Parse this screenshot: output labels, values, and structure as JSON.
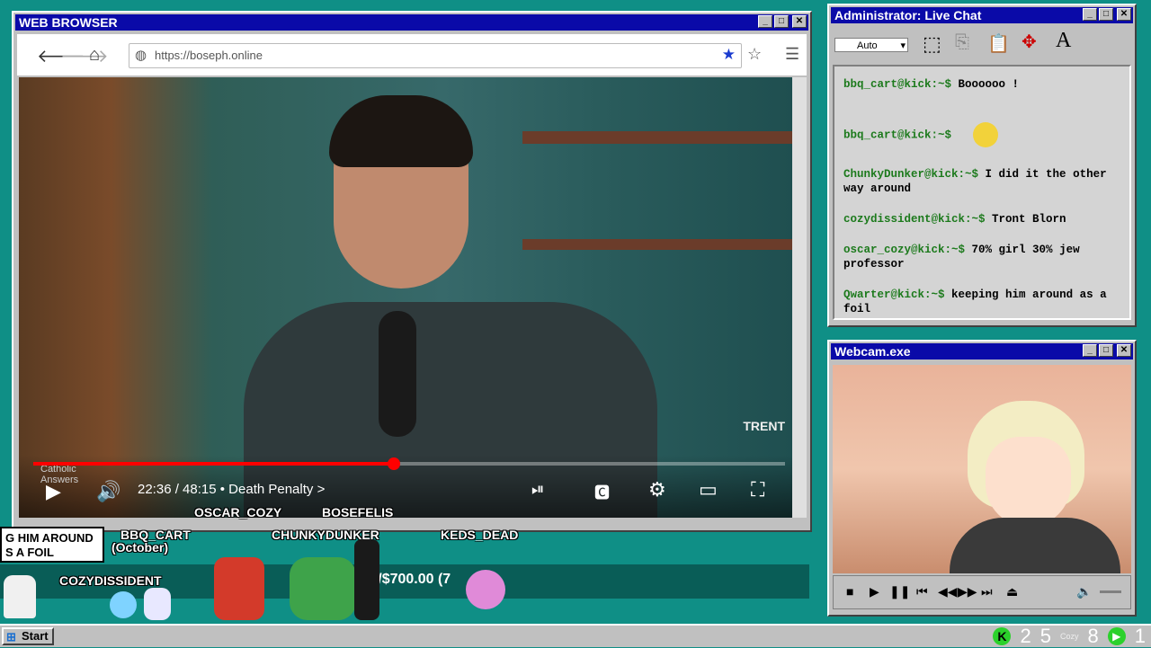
{
  "browser": {
    "title": "WEB BROWSER",
    "url": "https://boseph.online",
    "video": {
      "time": "22:36 / 48:15",
      "chapter": "Death Penalty",
      "chapter_arrow": ">",
      "brand_watermark": "TRENT",
      "channel_watermark_line1": "Catholic",
      "channel_watermark_line2": "Answers",
      "progress": 0.48
    }
  },
  "chat": {
    "title": "Administrator: Live Chat",
    "select_value": "Auto",
    "messages": [
      {
        "user": "bbq_cart@kick:~$",
        "text": "Boooooo !"
      },
      {
        "user": "bbq_cart@kick:~$",
        "text": ""
      },
      {
        "user": "ChunkyDunker@kick:~$",
        "text": "I did it the other way around"
      },
      {
        "user": "cozydissident@kick:~$",
        "text": "Tront Blorn"
      },
      {
        "user": "oscar_cozy@kick:~$",
        "text": "70% girl 30% jew professor"
      },
      {
        "user": "Qwarter@kick:~$",
        "text": "keeping him around as a foil"
      }
    ]
  },
  "webcam": {
    "title": "Webcam.exe"
  },
  "overlay": {
    "speech_line1": "G HIM AROUND",
    "speech_line2": "S A FOIL",
    "nicks": [
      "OSCAR_COZY",
      "BOSEFELIS",
      "BBQ_CART",
      "CHUNKYDUNKER",
      "KEDS_DEAD",
      "COZYDISSIDENT"
    ],
    "october": "(October)",
    "goal_text": ".00/$700.00 (7"
  },
  "taskbar": {
    "start": "Start",
    "tray_1": "2",
    "tray_2": "5",
    "tray_3": "Cozy",
    "tray_4": "8",
    "tray_5": "1"
  },
  "colors": {
    "desktop": "#0f8f86",
    "titlebar": "#0a0aa8",
    "chat_user": "#1c7a1c",
    "progress": "#ff0000"
  }
}
